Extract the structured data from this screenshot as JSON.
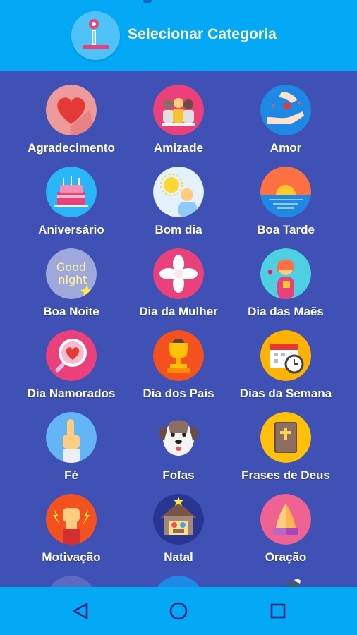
{
  "header": {
    "title": "Selecionar Categoria",
    "logo_icon": "app-logo-icon",
    "colors": {
      "appbar": "#03a9f4",
      "background": "#3f51b5"
    }
  },
  "categories": [
    {
      "label": "Agradecimento",
      "icon": "heart-icon"
    },
    {
      "label": "Amizade",
      "icon": "friends-icon"
    },
    {
      "label": "Amor",
      "icon": "hands-heart-icon"
    },
    {
      "label": "Aniversário",
      "icon": "cake-icon"
    },
    {
      "label": "Bom dia",
      "icon": "sun-person-icon"
    },
    {
      "label": "Boa Tarde",
      "icon": "sunset-icon"
    },
    {
      "label": "Boa Noite",
      "icon": "good-night-icon"
    },
    {
      "label": "Dia da Mulher",
      "icon": "flower-icon"
    },
    {
      "label": "Dia das Maẽs",
      "icon": "mother-icon"
    },
    {
      "label": "Dia Namorados",
      "icon": "magnifier-heart-icon"
    },
    {
      "label": "Dia dos Pais",
      "icon": "trophy-icon"
    },
    {
      "label": "Dias da Semana",
      "icon": "calendar-clock-icon"
    },
    {
      "label": "Fé",
      "icon": "pointing-hand-icon"
    },
    {
      "label": "Fofas",
      "icon": "dog-icon"
    },
    {
      "label": "Frases de Deus",
      "icon": "bible-icon"
    },
    {
      "label": "Motivação",
      "icon": "fist-icon"
    },
    {
      "label": "Natal",
      "icon": "nativity-icon"
    },
    {
      "label": "Oração",
      "icon": "praying-hands-icon"
    }
  ],
  "nav": {
    "back_icon": "back-triangle-icon",
    "home_icon": "home-circle-icon",
    "recents_icon": "recents-square-icon"
  }
}
